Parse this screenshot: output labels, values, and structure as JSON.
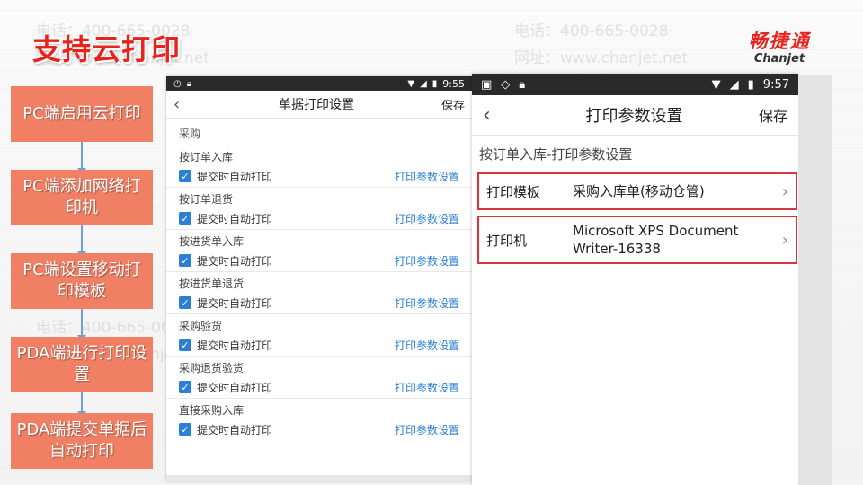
{
  "slide": {
    "title": "支持云打印",
    "logo_cn": "畅捷通",
    "logo_en": "Chanjet",
    "watermark_phone": "电话：400-665-0028",
    "watermark_web": "网址：www.chanjet.net"
  },
  "steps": [
    "PC端启用云打印",
    "PC端添加网络打印机",
    "PC端设置移动打印模板",
    "PDA端进行打印设置",
    "PDA端提交单据后自动打印"
  ],
  "phone1": {
    "time": "9:55",
    "title": "单据打印设置",
    "save": "保存",
    "section": "采购",
    "groups": [
      {
        "title": "按订单入库",
        "option": "提交时自动打印",
        "link": "打印参数设置"
      },
      {
        "title": "按订单退货",
        "option": "提交时自动打印",
        "link": "打印参数设置"
      },
      {
        "title": "按进货单入库",
        "option": "提交时自动打印",
        "link": "打印参数设置"
      },
      {
        "title": "按进货单退货",
        "option": "提交时自动打印",
        "link": "打印参数设置"
      },
      {
        "title": "采购验货",
        "option": "提交时自动打印",
        "link": "打印参数设置"
      },
      {
        "title": "采购退货验货",
        "option": "提交时自动打印",
        "link": "打印参数设置"
      },
      {
        "title": "直接采购入库",
        "option": "提交时自动打印",
        "link": "打印参数设置"
      }
    ]
  },
  "phone2": {
    "time": "9:57",
    "title": "打印参数设置",
    "save": "保存",
    "subheader": "按订单入库-打印参数设置",
    "rows": [
      {
        "key": "打印模板",
        "value": "采购入库单(移动仓管)"
      },
      {
        "key": "打印机",
        "value": "Microsoft XPS Document Writer-16338"
      }
    ]
  },
  "colors": {
    "accent": "#e8231c",
    "step": "#f07f63",
    "link": "#2b7fd6",
    "highlight": "#d9353a"
  }
}
